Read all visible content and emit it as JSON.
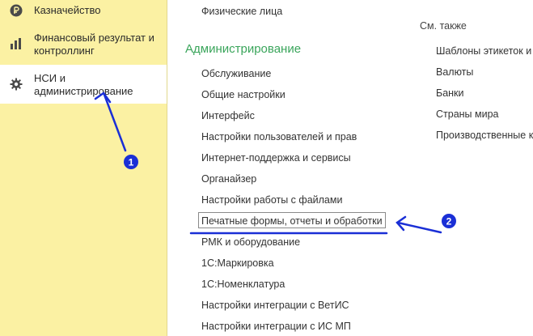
{
  "sidebar": {
    "items": [
      {
        "label": "Казначейство",
        "icon": "ruble-icon"
      },
      {
        "label_line1": "Финансовый результат и",
        "label_line2": "контроллинг",
        "icon": "bar-chart-icon"
      },
      {
        "label_line1": "НСИ и",
        "label_line2": "администрирование",
        "icon": "gear-icon",
        "active": true
      }
    ]
  },
  "main": {
    "top_link": "Физические лица",
    "section_title": "Администрирование",
    "links": [
      "Обслуживание",
      "Общие настройки",
      "Интерфейс",
      "Настройки пользователей и прав",
      "Интернет-поддержка и сервисы",
      "Органайзер",
      "Настройки работы с файлами",
      "Печатные формы, отчеты и обработки",
      "РМК и оборудование",
      "1С:Маркировка",
      "1С:Номенклатура",
      "Настройки интеграции с ВетИС",
      "Настройки интеграции с ИС МП"
    ],
    "see_also_title": "См. также",
    "see_also": [
      "Шаблоны этикеток и",
      "Валюты",
      "Банки",
      "Страны мира",
      "Производственные к"
    ]
  },
  "annotations": {
    "badge1": "1",
    "badge2": "2",
    "color": "#1a2fd6"
  }
}
